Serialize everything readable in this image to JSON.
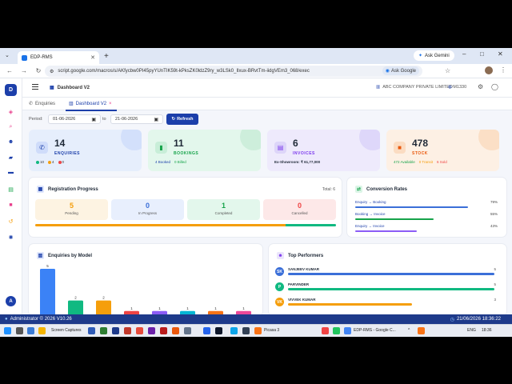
{
  "browser": {
    "tab_title": "EDP-RMS",
    "new_tab": "+",
    "gemini": "Ask Gemini",
    "url": "script.google.com/macros/s/AKfycbw0PI45pyYUnTIK59t-kPksZK0ldzZ9ry_w3LSk0_Ilxux-BRvtTm-iidgVEm3_068/exec",
    "ask_google": "Ask Google"
  },
  "sidebar": {
    "logo": "D",
    "avatar": "A",
    "icons": [
      {
        "name": "dashboard-icon",
        "color": "#e83e8c"
      },
      {
        "name": "search-icon",
        "color": "#e83e8c"
      },
      {
        "name": "users-icon",
        "color": "#1c3faa"
      },
      {
        "name": "folder-icon",
        "color": "#1c3faa"
      },
      {
        "name": "car-icon",
        "color": "#1c3faa"
      },
      {
        "name": "document-icon",
        "color": "#16a34a"
      },
      {
        "name": "box-icon",
        "color": "#e83e8c"
      },
      {
        "name": "history-icon",
        "color": "#f59e0b"
      },
      {
        "name": "settings-icon",
        "color": "#1c3faa"
      }
    ]
  },
  "header": {
    "title": "Dashboard V2",
    "company": "ABC COMPANY PRIVATE LIMITED",
    "user": "M1330"
  },
  "tabs": {
    "enquiries": "Enquiries",
    "dashboard": "Dashboard V2",
    "close": "×"
  },
  "filters": {
    "period_label": "Period:",
    "from": "01-06-2026",
    "to_label": "to",
    "to": "21-06-2026",
    "refresh": "Refresh"
  },
  "kpis": {
    "enquiries": {
      "value": "14",
      "label": "ENQUIRIES",
      "s1": "10",
      "s2": "4",
      "s3": "0"
    },
    "bookings": {
      "value": "11",
      "label": "BOOKINGS",
      "s1": "4 Booked",
      "s2": "0 Billed"
    },
    "invoices": {
      "value": "6",
      "label": "INVOICES",
      "s1": "Ex-Showroom: ₹ 61,77,000"
    },
    "stock": {
      "value": "478",
      "label": "STOCK",
      "s1": "472 Available",
      "s2": "0 Transit",
      "s3": "6 Sold"
    }
  },
  "registration": {
    "title": "Registration Progress",
    "total": "Total: 6",
    "pending": {
      "value": "5",
      "label": "Pending"
    },
    "in_progress": {
      "value": "0",
      "label": "In Progress"
    },
    "completed": {
      "value": "1",
      "label": "Completed"
    },
    "cancelled": {
      "value": "0",
      "label": "Cancelled"
    },
    "progress": {
      "pending_fraction": 0.833,
      "completed_fraction": 0.167
    }
  },
  "conversion": {
    "title": "Conversion Rates",
    "rows": [
      {
        "label": "Enquiry → Booking",
        "pct": "79%",
        "value": 0.79,
        "color": "#3b6fd8"
      },
      {
        "label": "Booking → Invoice",
        "pct": "55%",
        "value": 0.55,
        "color": "#16a34a"
      },
      {
        "label": "Enquiry → Invoice",
        "pct": "43%",
        "value": 0.43,
        "color": "#8b5cf6"
      }
    ]
  },
  "chart_data": {
    "type": "bar",
    "title": "Enquiries by Model",
    "categories": [
      "",
      "",
      "",
      "",
      "",
      "",
      "",
      ""
    ],
    "values": [
      5,
      2,
      2,
      1,
      1,
      1,
      1,
      1
    ],
    "colors": [
      "#3b82f6",
      "#10b981",
      "#f59e0b",
      "#ef4444",
      "#8b5cf6",
      "#06b6d4",
      "#f97316",
      "#ec4899"
    ],
    "ylim": [
      0,
      5
    ],
    "grid": false
  },
  "performers": {
    "title": "Top Performers",
    "rows": [
      {
        "initials": "SK",
        "name": "SANJEEV KUMAR",
        "count": "5",
        "value": 1.0,
        "color": "#3b6fd8"
      },
      {
        "initials": "P",
        "name": "PARVINDER",
        "count": "5",
        "value": 1.0,
        "color": "#10b981"
      },
      {
        "initials": "VK",
        "name": "VIVVEK KUMAR",
        "count": "3",
        "value": 0.6,
        "color": "#f59e0b"
      }
    ]
  },
  "footer": {
    "left": "Administrator © 2026 V10.26",
    "right": "21/06/2026 18:36:22"
  },
  "taskbar": {
    "screen_captures": "Screen Captures",
    "picasa": "Picasa 3",
    "edp": "EDP-RMS - Google C...",
    "lang": "ENG",
    "time": "18:36"
  }
}
